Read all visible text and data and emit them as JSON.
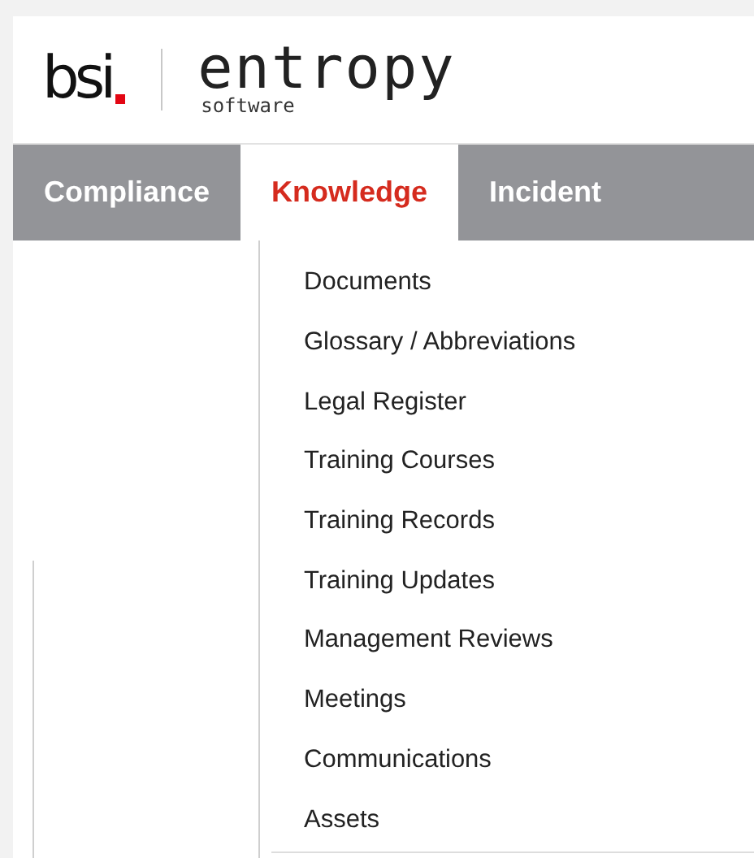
{
  "logo": {
    "brand": "bsi",
    "product": "entropy",
    "product_tagline": "software"
  },
  "nav_tabs": [
    {
      "label": "Compliance",
      "selected": false
    },
    {
      "label": "Knowledge",
      "selected": true
    },
    {
      "label": "Incident",
      "selected": false
    }
  ],
  "dropdown_menu": {
    "items": [
      "Documents",
      "Glossary / Abbreviations",
      "Legal Register",
      "Training Courses",
      "Training Records",
      "Training Updates",
      "Management Reviews",
      "Meetings",
      "Communications",
      "Assets"
    ]
  }
}
